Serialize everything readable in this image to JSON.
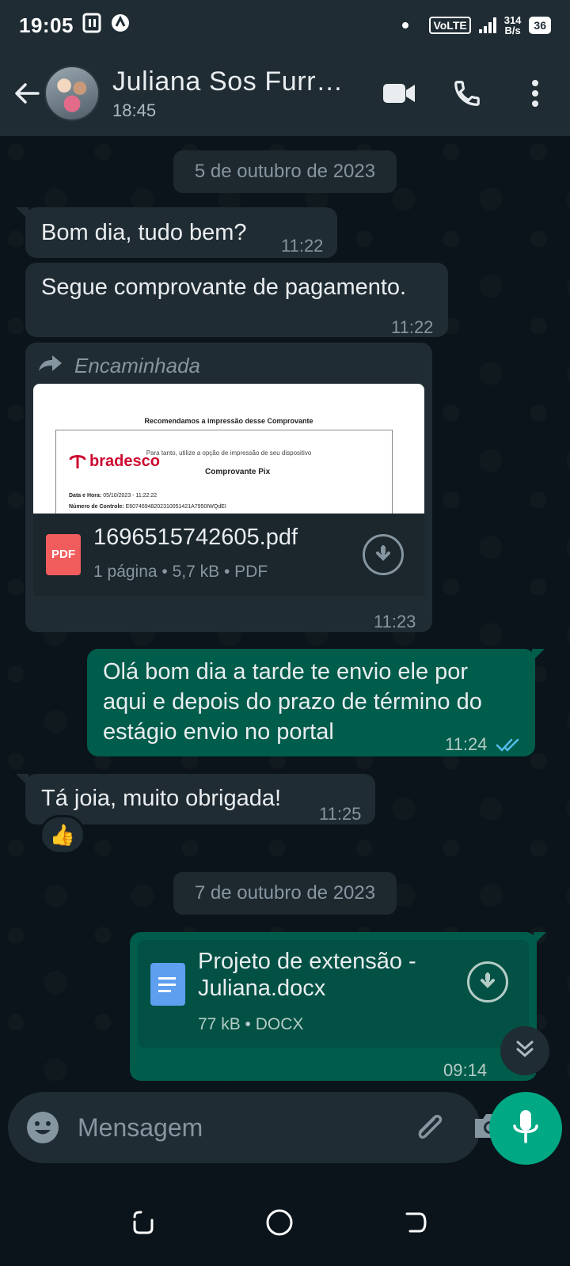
{
  "status_bar": {
    "time": "19:05",
    "network": "VoLTE",
    "data_rate_value": "314",
    "data_rate_unit": "B/s",
    "battery": "36"
  },
  "header": {
    "contact_name": "Juliana Sos Furr…",
    "subtitle": "18:45"
  },
  "messages": {
    "date1": "5 de outubro de 2023",
    "m1": {
      "text": "Bom dia, tudo bem?",
      "time": "11:22"
    },
    "m2": {
      "text": "Segue comprovante de pagamento.",
      "time": "11:22"
    },
    "m3": {
      "forwarded_label": "Encaminhada",
      "preview": {
        "title": "Recomendamos a impressão desse Comprovante",
        "subtitle": "Para tanto, utilize a opção de impressão de seu dispositivo",
        "logo": "bradesco",
        "doc_title": "Comprovante Pix",
        "line1_label": "Data e Hora:",
        "line1_value": "05/10/2023 - 11:22:22",
        "line2_label": "Número de Controle:",
        "line2_value": "E60746948202310051421A7950IWQdEI"
      },
      "file_icon_label": "PDF",
      "file_name": "1696515742605.pdf",
      "file_detail": "1 página • 5,7 kB • PDF",
      "time": "11:23"
    },
    "m4": {
      "line1": "Olá bom dia a tarde te envio ele por",
      "line2": "aqui e depois do prazo de término do",
      "line3": "estágio envio no portal",
      "time": "11:24"
    },
    "m5": {
      "text": "Tá joia, muito obrigada!",
      "time": "11:25",
      "reaction": "👍"
    },
    "date2": "7 de outubro de 2023",
    "m6": {
      "file_name_line1": "Projeto de extensão -",
      "file_name_line2": "Juliana.docx",
      "file_detail": "77 kB • DOCX",
      "time": "09:14"
    }
  },
  "input": {
    "placeholder": "Mensagem"
  },
  "colors": {
    "header_bg": "#1f2c34",
    "chat_bg": "#0b141a",
    "incoming_bubble": "#202c33",
    "outgoing_bubble": "#005c4b",
    "accent": "#00a884",
    "read_ticks": "#53bdeb"
  },
  "icons": {
    "back": "arrow-left-icon",
    "video": "video-camera-icon",
    "call": "phone-icon",
    "menu": "more-vertical-icon",
    "forward": "forward-arrow-icon",
    "download": "download-icon",
    "emoji": "emoji-icon",
    "attach": "paperclip-icon",
    "camera": "camera-icon",
    "mic": "microphone-icon",
    "scroll": "double-chevron-down-icon"
  }
}
